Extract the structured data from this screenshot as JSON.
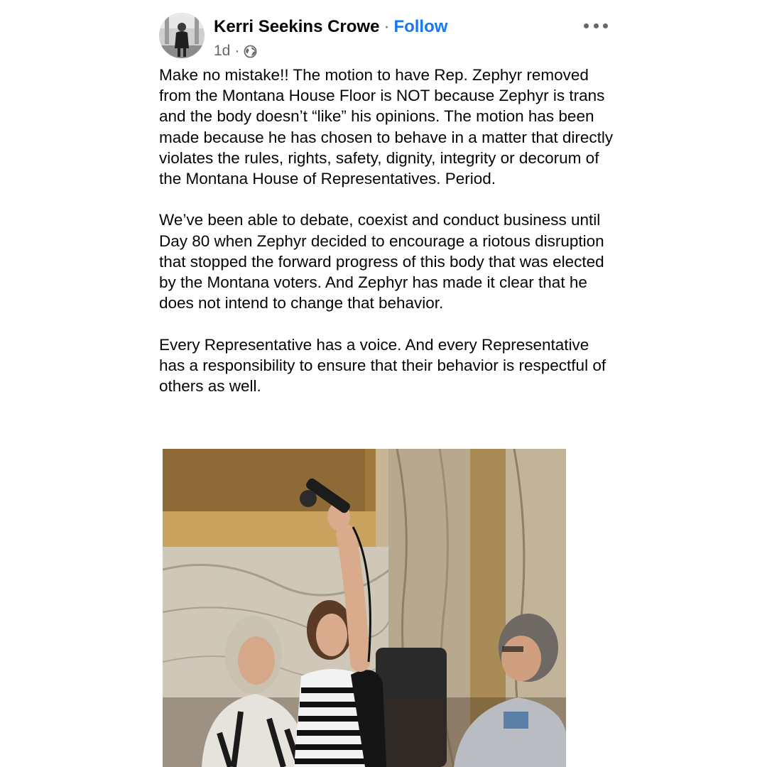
{
  "post": {
    "author": {
      "name": "Kerri Seekins Crowe",
      "separator": "·",
      "follow_label": "Follow",
      "avatar_icon": "profile-photo"
    },
    "meta": {
      "time": "1d",
      "separator": "·",
      "audience_icon": "globe-icon"
    },
    "more_icon": "more-options-icon",
    "paragraphs": [
      "Make no mistake!! The motion to have Rep. Zephyr removed from the Montana House Floor is NOT because Zephyr is trans and the body doesn’t “like” his opinions. The motion has been made because he has chosen to behave in a matter that directly violates the rules, rights, safety, dignity, integrity or decorum of the Montana House of Representatives.  Period.",
      "We’ve been able to debate, coexist and conduct business until Day 80 when Zephyr decided to encourage a riotous disruption that stopped the forward progress of this body that was elected by the Montana voters. And Zephyr has made it clear that he does not intend to change that behavior.",
      "Every Representative has a voice. And every Representative has a responsibility to ensure that their behavior is respectful of others as well."
    ],
    "photo_icon": "post-photo"
  },
  "colors": {
    "text": "#050505",
    "secondary": "#65676b",
    "link": "#1877f2",
    "background": "#ffffff"
  }
}
